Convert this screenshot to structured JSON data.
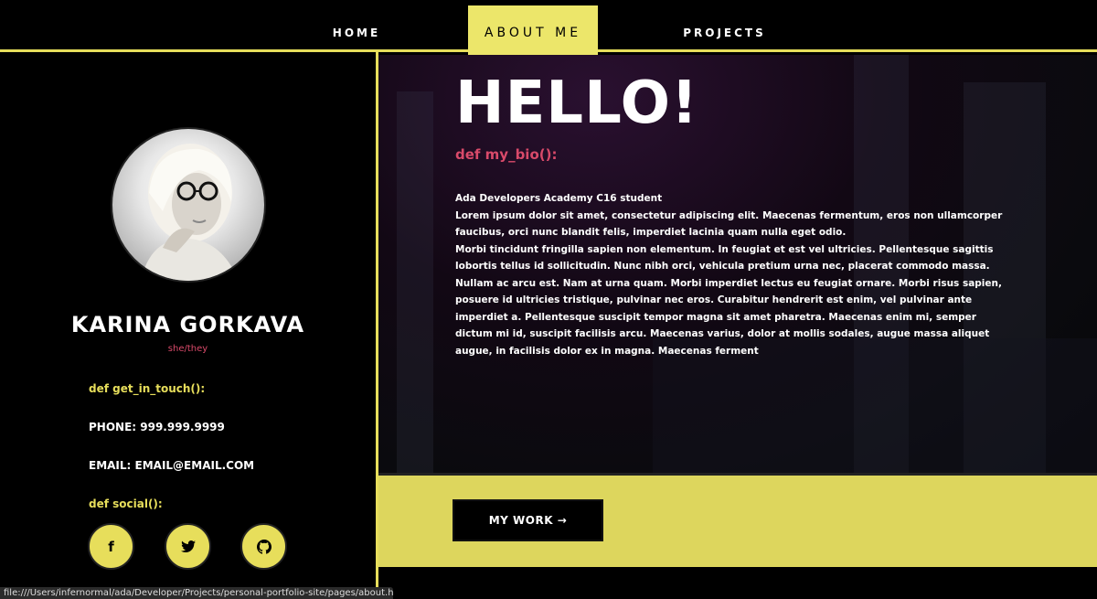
{
  "nav": {
    "home": "HOME",
    "about": "ABOUT ME",
    "projects": "PROJECTS"
  },
  "sidebar": {
    "name": "KARINA GORKAVA",
    "pronouns": "she/they",
    "contact_def": "def get_in_touch():",
    "phone": "PHONE: 999.999.9999",
    "email": "EMAIL: EMAIL@EMAIL.COM",
    "social_def": "def social():",
    "social": [
      {
        "icon": "facebook-icon",
        "glyph": "f"
      },
      {
        "icon": "twitter-icon",
        "glyph": "🐦"
      },
      {
        "icon": "github-icon",
        "glyph": "◉"
      }
    ]
  },
  "hero": {
    "title": "HELLO!",
    "bio_def": "def my_bio():",
    "bio_line1": "Ada Developers Academy C16 student",
    "bio_line2": "Lorem ipsum dolor sit amet, consectetur adipiscing elit. Maecenas fermentum, eros non ullamcorper faucibus, orci nunc blandit felis, imperdiet lacinia quam nulla eget odio.",
    "bio_line3": "Morbi tincidunt fringilla sapien non elementum. In feugiat et est vel ultricies. Pellentesque sagittis lobortis tellus id sollicitudin. Nunc nibh orci, vehicula pretium urna nec, placerat commodo massa.",
    "bio_line4": "Nullam ac arcu est. Nam at urna quam. Morbi imperdiet lectus eu feugiat ornare. Morbi risus sapien, posuere id ultricies tristique, pulvinar nec eros. Curabitur hendrerit est enim, vel pulvinar ante imperdiet a. Pellentesque suscipit tempor magna sit amet pharetra. Maecenas enim mi, semper dictum mi id, suscipit facilisis arcu. Maecenas varius, dolor at mollis sodales, augue massa aliquet augue, in facilisis dolor ex in magna. Maecenas ferment"
  },
  "cta": {
    "label": "MY WORK →"
  },
  "status_url": "file:///Users/infernormal/ada/Developer/Projects/personal-portfolio-site/pages/about.html",
  "colors": {
    "accent_yellow": "#e7de5b",
    "accent_pink": "#d94a6a",
    "background": "#000000"
  }
}
